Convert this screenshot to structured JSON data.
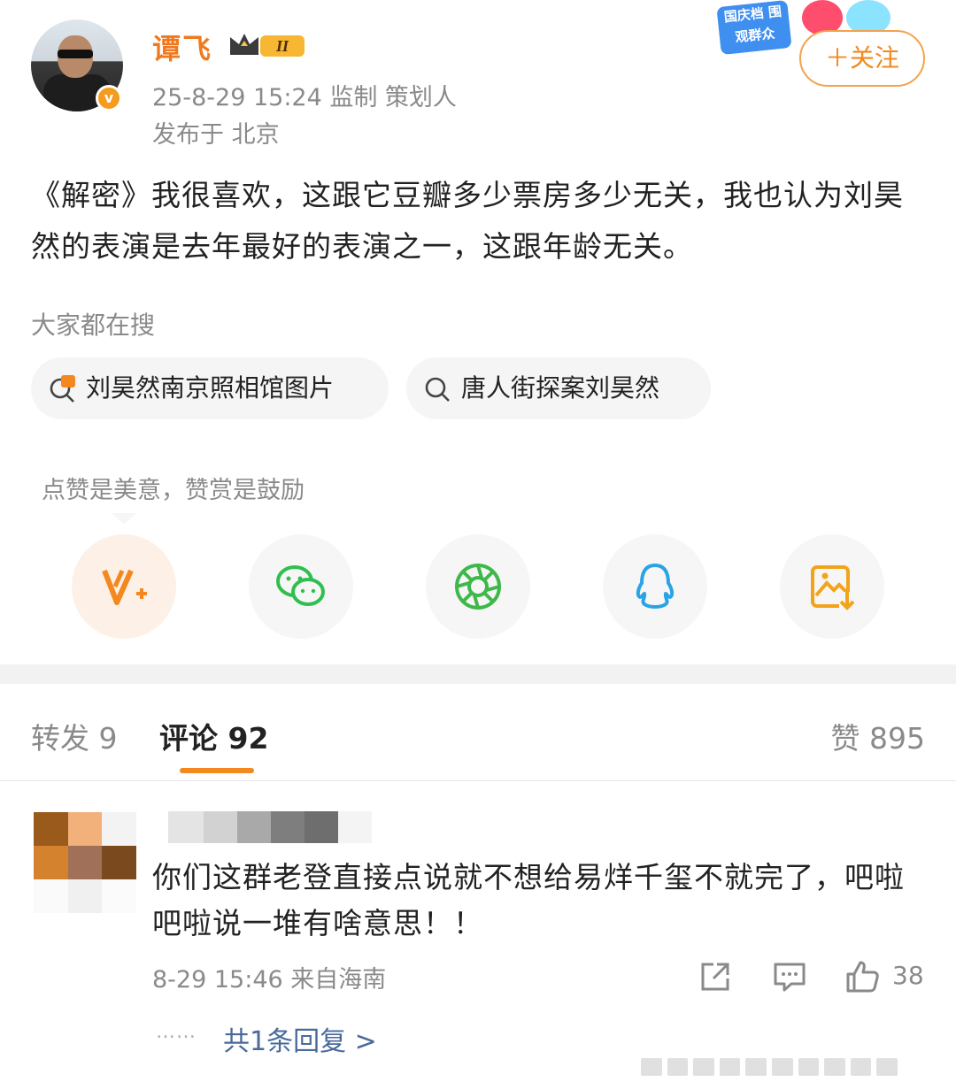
{
  "post": {
    "author": "谭飞",
    "level_badge": "II",
    "time_and_tags": "25-8-29 15:24  监制 策划人",
    "location": "发布于 北京",
    "follow_label": "＋关注",
    "promo_tag": "国庆档 围观群众",
    "content": "《解密》我很喜欢，这跟它豆瓣多少票房多少无关，我也认为刘昊然的表演是去年最好的表演之一，这跟年龄无关。"
  },
  "search": {
    "title": "大家都在搜",
    "chips": [
      {
        "label": "刘昊然南京照相馆图片",
        "icon": "hot-search-icon"
      },
      {
        "label": "唐人街探案刘昊然",
        "icon": "search-icon"
      }
    ]
  },
  "share": {
    "note": "点赞是美意，赞赏是鼓励",
    "targets": [
      "weibo-reward-icon",
      "wechat-icon",
      "moments-icon",
      "qq-icon",
      "save-image-icon"
    ]
  },
  "tabs": {
    "repost": "转发 9",
    "comment": "评论 92",
    "like": "赞 895"
  },
  "comment": {
    "text": "你们这群老登直接点说就不想给易烊千玺不就完了，吧啦吧啦说一堆有啥意思！！",
    "time_location": "8-29 15:46 来自海南",
    "like_count": "38",
    "replies_label": "共1条回复 >",
    "dots": "……"
  },
  "colors": {
    "accent": "#f5871f",
    "username": "#f0791e",
    "muted": "#8a8a8a",
    "link": "#4a6a9a"
  }
}
